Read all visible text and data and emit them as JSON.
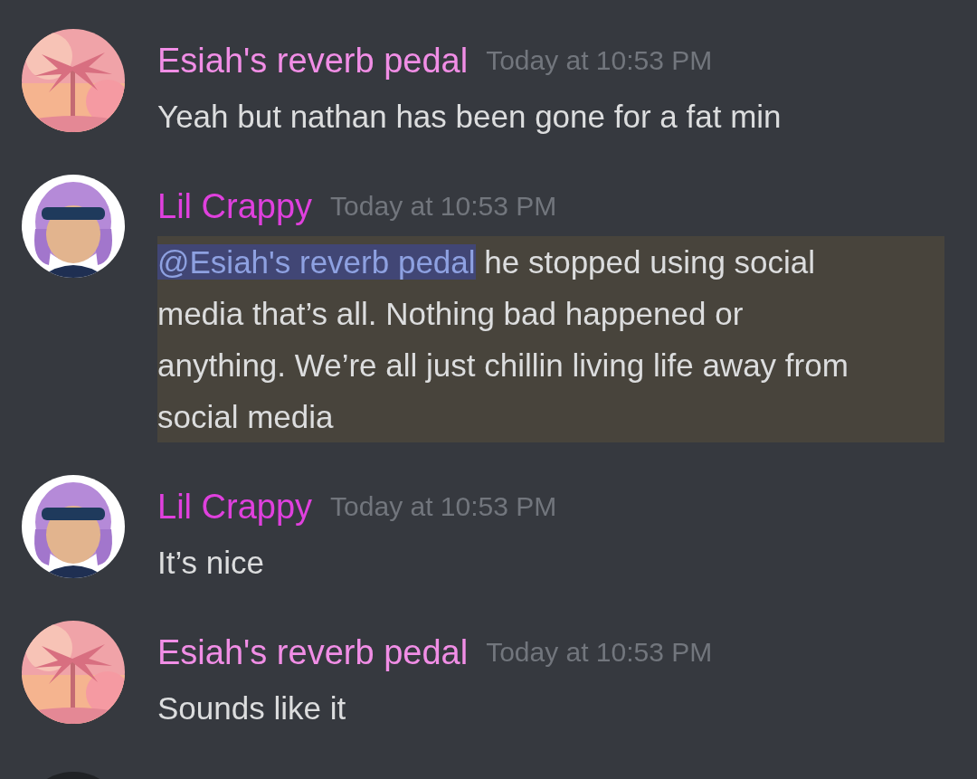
{
  "messages": [
    {
      "author": "Esiah's reverb pedal",
      "color": "#f18ee6",
      "time": "Today at 10:53 PM",
      "mentioned": false,
      "content": [
        {
          "kind": "text",
          "text": "Yeah but nathan has been gone for a fat min"
        }
      ]
    },
    {
      "author": "Lil Crappy",
      "color": "#e040de",
      "kind": "cartoon",
      "time": "Today at 10:53 PM",
      "mentioned": true,
      "content": [
        {
          "kind": "mention",
          "text": "@Esiah's reverb pedal"
        },
        {
          "kind": "text",
          "text": " he stopped using social media that’s all. Nothing bad happened or anything. We’re all just chillin living life away from social media"
        }
      ]
    },
    {
      "author": "Lil Crappy",
      "color": "#e040de",
      "kind": "cartoon",
      "time": "Today at 10:53 PM",
      "mentioned": false,
      "content": [
        {
          "kind": "text",
          "text": "It’s nice"
        }
      ]
    },
    {
      "author": "Esiah's reverb pedal",
      "color": "#f18ee6",
      "time": "Today at 10:53 PM",
      "mentioned": false,
      "content": [
        {
          "kind": "text",
          "text": "Sounds like it"
        }
      ]
    }
  ]
}
